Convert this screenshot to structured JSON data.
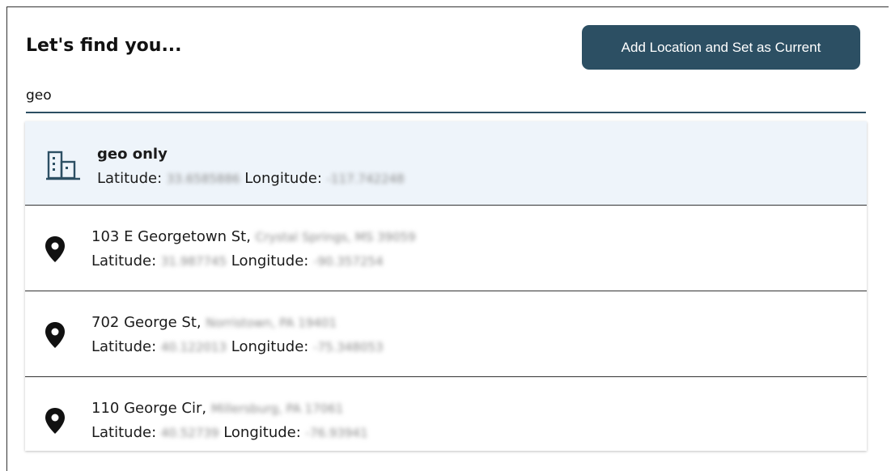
{
  "header": {
    "title": "Let's find you...",
    "add_button_label": "Add Location and Set as Current"
  },
  "search": {
    "value": "geo",
    "placeholder": ""
  },
  "labels": {
    "latitude": "Latitude:",
    "longitude": "Longitude:"
  },
  "results": [
    {
      "type": "building-icon",
      "name": "geo only",
      "locality": "",
      "latitude": "33.6585886",
      "longitude": "-117.742248",
      "selected": true
    },
    {
      "type": "map-pin-icon",
      "name": "103 E Georgetown St,",
      "locality": "Crystal Springs, MS 39059",
      "latitude": "31.987745",
      "longitude": "-90.357254",
      "selected": false
    },
    {
      "type": "map-pin-icon",
      "name": "702 George St,",
      "locality": "Norristown, PA 19401",
      "latitude": "40.122013",
      "longitude": "-75.348053",
      "selected": false
    },
    {
      "type": "map-pin-icon",
      "name": "110 George Cir,",
      "locality": "Millersburg, PA 17061",
      "latitude": "40.52739",
      "longitude": "-76.93941",
      "selected": false
    }
  ],
  "colors": {
    "accent": "#2c4f63",
    "selected_row": "#eef4fa"
  }
}
